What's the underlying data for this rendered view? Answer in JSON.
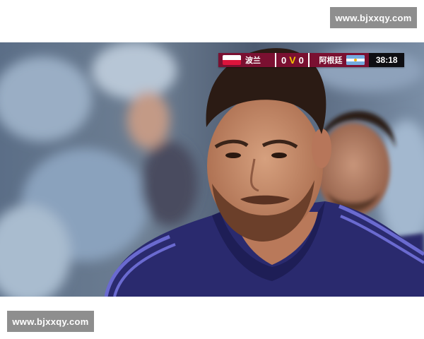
{
  "watermarks": {
    "top": "www.bjxxqy.com",
    "bottom": "www.bjxxqy.com"
  },
  "scoreboard": {
    "home_team": "波兰",
    "home_flag": "poland-flag-icon",
    "home_score": "0",
    "away_score": "0",
    "away_team": "阿根廷",
    "away_flag": "argentina-flag-icon",
    "match_clock": "38:18",
    "tournament_logo": "V",
    "colors": {
      "bar": "#7a1031",
      "clock_bg": "#0e0e12",
      "logo": "#f5c400"
    }
  },
  "video": {
    "kit_color": "#2a2a6e",
    "stripe_color": "#6a6ad0"
  }
}
